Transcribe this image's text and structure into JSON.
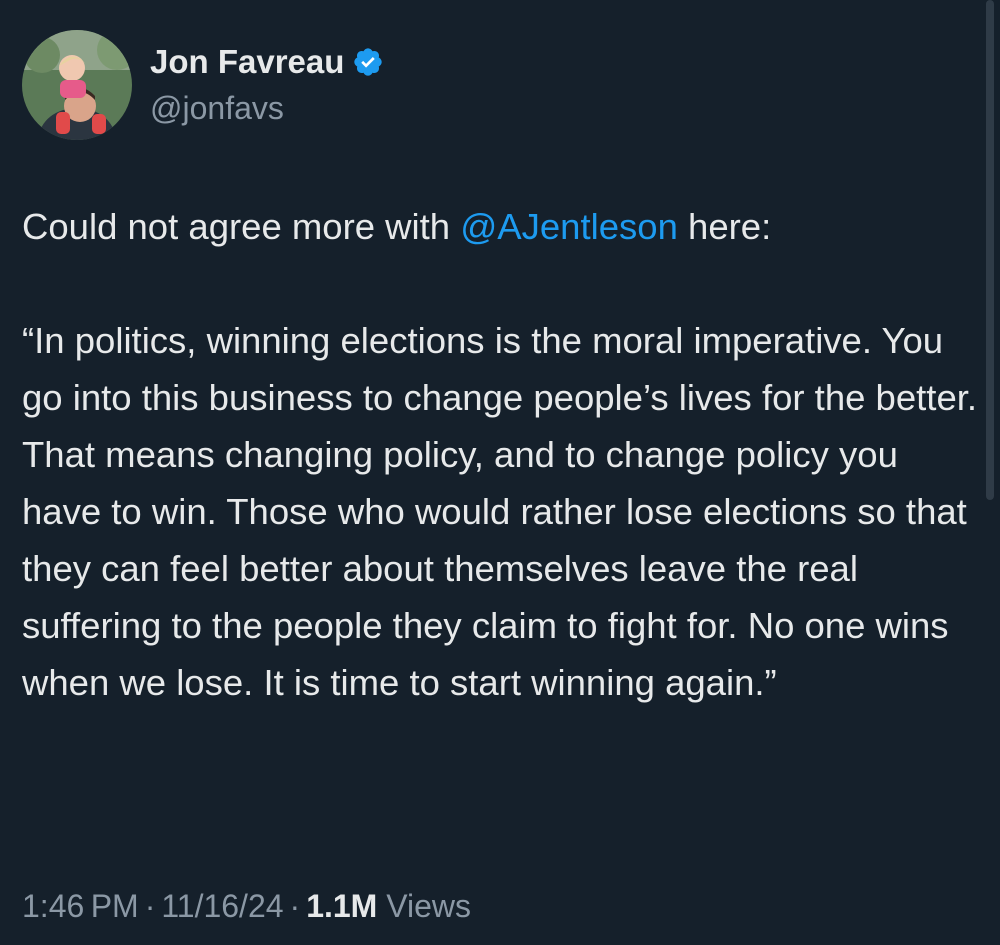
{
  "author": {
    "display_name": "Jon Favreau",
    "handle": "@jonfavs",
    "verified": true,
    "avatar_icon": "profile-photo-icon"
  },
  "tweet": {
    "intro_before": "Could not agree more with ",
    "mention": "@AJentleson",
    "intro_after": " here:",
    "quote": "“In politics, winning elections is the moral imperative. You go into this business to change people’s lives for the better. That means changing policy, and to change policy you have to win. Those who would rather lose elections so that they can feel better about themselves leave the real suffering to the people they claim to fight for. No one wins when we lose. It is time to start winning again.”"
  },
  "meta": {
    "time": "1:46 PM",
    "separator": "·",
    "date": "11/16/24",
    "views_count": "1.1M",
    "views_label": "Views"
  },
  "colors": {
    "background": "#15202b",
    "text": "#e7e9ea",
    "secondary": "#8b98a5",
    "accent": "#1d9bf0"
  }
}
